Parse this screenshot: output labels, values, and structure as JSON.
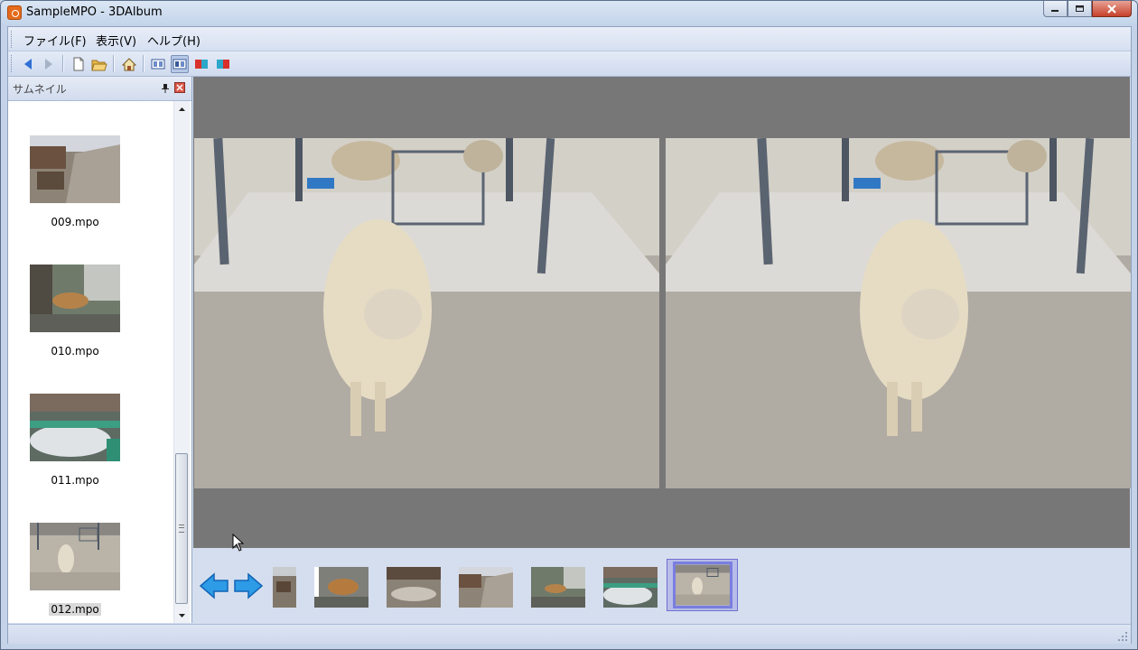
{
  "window": {
    "title": "SampleMPO - 3DAlbum"
  },
  "menu": {
    "items": [
      "ファイル(F)",
      "表示(V)",
      "ヘルプ(H)"
    ]
  },
  "toolbar": {
    "buttons": [
      "back-icon",
      "forward-icon",
      "new-file-icon",
      "open-folder-icon",
      "home-icon",
      "view-parallel-icon",
      "view-cross-icon",
      "anaglyph-red-cyan-icon",
      "anaglyph-cyan-red-icon"
    ]
  },
  "sidebar": {
    "title": "サムネイル",
    "thumbnails": [
      {
        "label": "009.mpo",
        "selected": false
      },
      {
        "label": "010.mpo",
        "selected": false
      },
      {
        "label": "011.mpo",
        "selected": false
      },
      {
        "label": "012.mpo",
        "selected": true
      }
    ]
  },
  "colors": {
    "viewer_bg": "#777777",
    "selection_outline": "#7a7ee0",
    "window_frame": "#c4d3e8"
  }
}
